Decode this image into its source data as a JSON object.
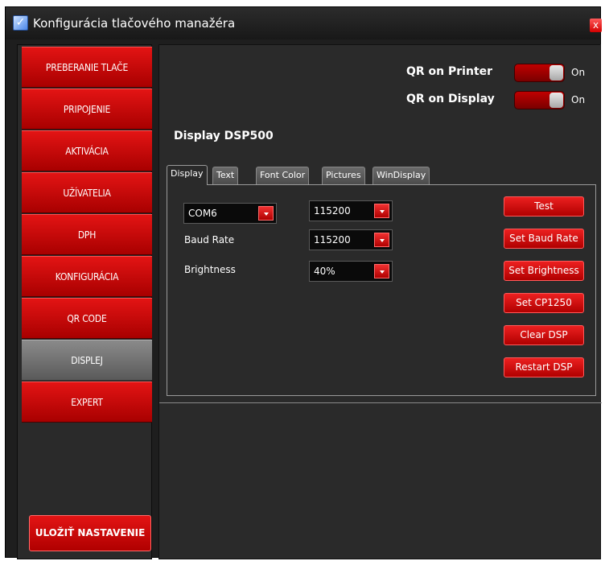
{
  "window": {
    "title": "Konfigurácia tlačového manažéra",
    "close_label": "x"
  },
  "sidebar": {
    "items": [
      {
        "label": "PREBERANIE TLAČE"
      },
      {
        "label": "PRIPOJENIE"
      },
      {
        "label": "AKTIVÁCIA"
      },
      {
        "label": "UŽÍVATELIA"
      },
      {
        "label": "DPH"
      },
      {
        "label": "KONFIGURÁCIA"
      },
      {
        "label": "QR CODE"
      },
      {
        "label": "DISPLEJ",
        "active": true
      },
      {
        "label": "EXPERT"
      }
    ],
    "save_label": "ULOŽIŤ NASTAVENIE"
  },
  "toggles": {
    "printer": {
      "label": "QR on Printer",
      "state": "On"
    },
    "display": {
      "label": "QR on Display",
      "state": "On"
    }
  },
  "section_title": "Display DSP500",
  "tabs": [
    "Display",
    "Text",
    "Font Color",
    "Pictures",
    "WinDisplay"
  ],
  "active_tab": "Display",
  "display_tab": {
    "port": "COM6",
    "port_baud": "115200",
    "baud_rate_label": "Baud Rate",
    "baud_rate": "115200",
    "brightness_label": "Brightness",
    "brightness": "40%"
  },
  "buttons": {
    "test": "Test",
    "set_baud": "Set Baud Rate",
    "set_brightness": "Set Brightness",
    "set_cp": "Set  CP1250",
    "clear": "Clear DSP",
    "restart": "Restart DSP"
  },
  "colors": {
    "accent_red": "#d00000",
    "active_gray": "#707070",
    "background": "#2a2a2a"
  }
}
